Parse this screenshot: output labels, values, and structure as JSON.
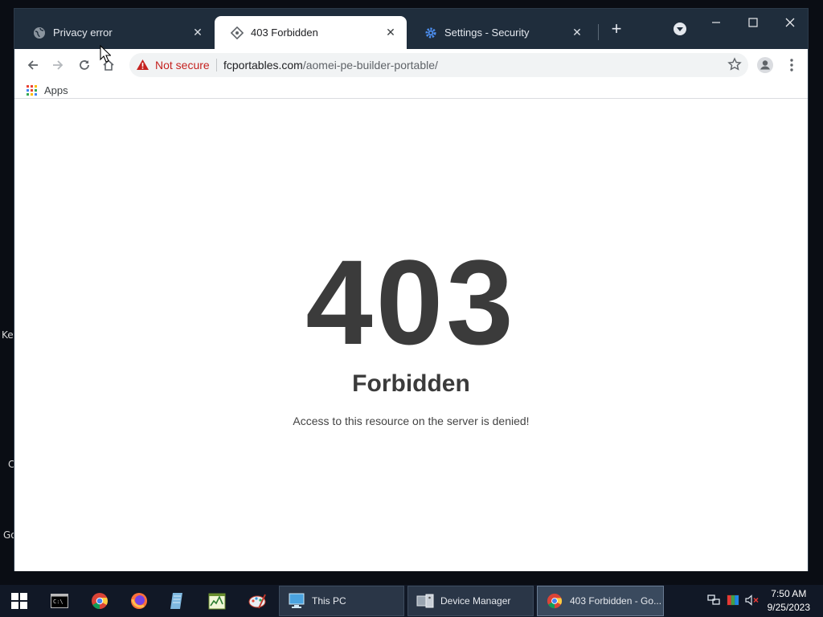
{
  "desktop": {
    "edge_labels": [
      "Key",
      "C",
      "Go"
    ]
  },
  "tabs": [
    {
      "title": "Privacy error",
      "favicon": "globe-icon",
      "active": false
    },
    {
      "title": "403 Forbidden",
      "favicon": "diamond-site-icon",
      "active": true
    },
    {
      "title": "Settings - Security",
      "favicon": "gear-icon",
      "active": false
    }
  ],
  "toolbar": {
    "security_label": "Not secure",
    "url_host": "fcportables.com",
    "url_path": "/aomei-pe-builder-portable/"
  },
  "bookmarks": {
    "apps_label": "Apps"
  },
  "page": {
    "code": "403",
    "title": "Forbidden",
    "message": "Access to this resource on the server is denied!"
  },
  "taskbar": {
    "tasks": [
      {
        "label": "This PC",
        "icon": "this-pc-icon"
      },
      {
        "label": "Device Manager",
        "icon": "device-manager-icon"
      },
      {
        "label": "403 Forbidden - Go...",
        "icon": "chrome-icon"
      }
    ],
    "clock_time": "7:50 AM",
    "clock_date": "9/25/2023"
  },
  "colors": {
    "tabstrip": "#1f2d3c",
    "not_secure": "#c5221f",
    "page_text": "#3b3b3b",
    "taskbar": "#111826"
  }
}
